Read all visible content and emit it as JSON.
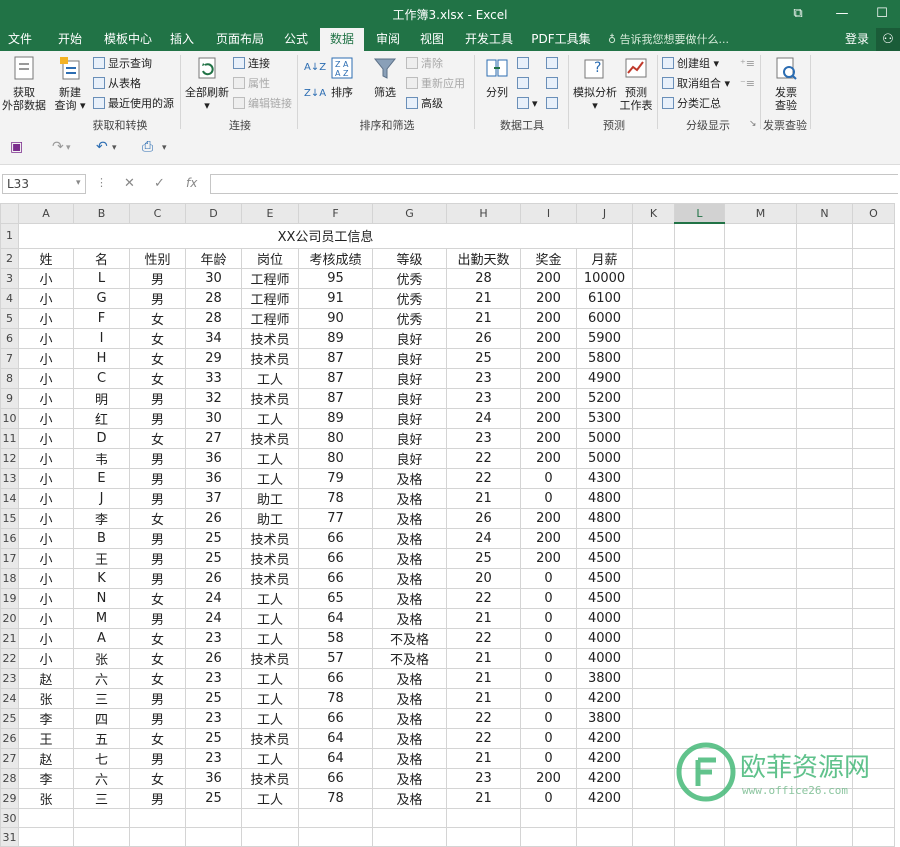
{
  "window": {
    "title": "工作簿3.xlsx - Excel",
    "controls": [
      "⧉",
      "—",
      "☐"
    ]
  },
  "tabs": [
    "文件",
    "开始",
    "模板中心",
    "插入",
    "页面布局",
    "公式",
    "数据",
    "审阅",
    "视图",
    "开发工具",
    "PDF工具集"
  ],
  "active_tab": "数据",
  "tell_me": "告诉我您想要做什么...",
  "login": "登录",
  "ribbon": {
    "groups": {
      "get_transform": "获取和转换",
      "connections": "连接",
      "sort_filter": "排序和筛选",
      "data_tools": "数据工具",
      "forecast": "预测",
      "outline": "分级显示",
      "invoice": "发票查验"
    },
    "get_external_l1": "获取",
    "get_external_l2": "外部数据",
    "new_query_l1": "新建",
    "new_query_l2": "查询",
    "show_queries": "显示查询",
    "from_table": "从表格",
    "recent_sources": "最近使用的源",
    "refresh_all": "全部刷新",
    "connections": "连接",
    "properties": "属性",
    "edit_links": "编辑链接",
    "sort": "排序",
    "filter": "筛选",
    "clear": "清除",
    "reapply": "重新应用",
    "advanced": "高级",
    "split": "分列",
    "what_if_l1": "模拟分析",
    "forecast_l1": "预测",
    "forecast_l2": "工作表",
    "group": "创建组",
    "ungroup": "取消组合",
    "subtotal": "分类汇总",
    "invoice_l1": "发票",
    "invoice_l2": "查验"
  },
  "namebox": "L33",
  "formula_symbols": {
    "cancel": "✕",
    "enter": "✓",
    "fx": "fx"
  },
  "sheet": {
    "columns": [
      "A",
      "B",
      "C",
      "D",
      "E",
      "F",
      "G",
      "H",
      "I",
      "J",
      "K",
      "L",
      "M",
      "N",
      "O"
    ],
    "selected_column": "L",
    "title": "XX公司员工信息",
    "headers": [
      "姓",
      "名",
      "性别",
      "年龄",
      "岗位",
      "考核成绩",
      "等级",
      "出勤天数",
      "奖金",
      "月薪"
    ],
    "rows": [
      [
        "小",
        "L",
        "男",
        "30",
        "工程师",
        "95",
        "优秀",
        "28",
        "200",
        "10000"
      ],
      [
        "小",
        "G",
        "男",
        "28",
        "工程师",
        "91",
        "优秀",
        "21",
        "200",
        "6100"
      ],
      [
        "小",
        "F",
        "女",
        "28",
        "工程师",
        "90",
        "优秀",
        "21",
        "200",
        "6000"
      ],
      [
        "小",
        "I",
        "女",
        "34",
        "技术员",
        "89",
        "良好",
        "26",
        "200",
        "5900"
      ],
      [
        "小",
        "H",
        "女",
        "29",
        "技术员",
        "87",
        "良好",
        "25",
        "200",
        "5800"
      ],
      [
        "小",
        "C",
        "女",
        "33",
        "工人",
        "87",
        "良好",
        "23",
        "200",
        "4900"
      ],
      [
        "小",
        "明",
        "男",
        "32",
        "技术员",
        "87",
        "良好",
        "23",
        "200",
        "5200"
      ],
      [
        "小",
        "红",
        "男",
        "30",
        "工人",
        "89",
        "良好",
        "24",
        "200",
        "5300"
      ],
      [
        "小",
        "D",
        "女",
        "27",
        "技术员",
        "80",
        "良好",
        "23",
        "200",
        "5000"
      ],
      [
        "小",
        "韦",
        "男",
        "36",
        "工人",
        "80",
        "良好",
        "22",
        "200",
        "5000"
      ],
      [
        "小",
        "E",
        "男",
        "36",
        "工人",
        "79",
        "及格",
        "22",
        "0",
        "4300"
      ],
      [
        "小",
        "J",
        "男",
        "37",
        "助工",
        "78",
        "及格",
        "21",
        "0",
        "4800"
      ],
      [
        "小",
        "李",
        "女",
        "26",
        "助工",
        "77",
        "及格",
        "26",
        "200",
        "4800"
      ],
      [
        "小",
        "B",
        "男",
        "25",
        "技术员",
        "66",
        "及格",
        "24",
        "200",
        "4500"
      ],
      [
        "小",
        "王",
        "男",
        "25",
        "技术员",
        "66",
        "及格",
        "25",
        "200",
        "4500"
      ],
      [
        "小",
        "K",
        "男",
        "26",
        "技术员",
        "66",
        "及格",
        "20",
        "0",
        "4500"
      ],
      [
        "小",
        "N",
        "女",
        "24",
        "工人",
        "65",
        "及格",
        "22",
        "0",
        "4500"
      ],
      [
        "小",
        "M",
        "男",
        "24",
        "工人",
        "64",
        "及格",
        "21",
        "0",
        "4000"
      ],
      [
        "小",
        "A",
        "女",
        "23",
        "工人",
        "58",
        "不及格",
        "22",
        "0",
        "4000"
      ],
      [
        "小",
        "张",
        "女",
        "26",
        "技术员",
        "57",
        "不及格",
        "21",
        "0",
        "4000"
      ],
      [
        "赵",
        "六",
        "女",
        "23",
        "工人",
        "66",
        "及格",
        "21",
        "0",
        "3800"
      ],
      [
        "张",
        "三",
        "男",
        "25",
        "工人",
        "78",
        "及格",
        "21",
        "0",
        "4200"
      ],
      [
        "李",
        "四",
        "男",
        "23",
        "工人",
        "66",
        "及格",
        "22",
        "0",
        "3800"
      ],
      [
        "王",
        "五",
        "女",
        "25",
        "技术员",
        "64",
        "及格",
        "22",
        "0",
        "4200"
      ],
      [
        "赵",
        "七",
        "男",
        "23",
        "工人",
        "64",
        "及格",
        "21",
        "0",
        "4200"
      ],
      [
        "李",
        "六",
        "女",
        "36",
        "技术员",
        "66",
        "及格",
        "23",
        "200",
        "4200"
      ],
      [
        "张",
        "三",
        "男",
        "25",
        "工人",
        "78",
        "及格",
        "21",
        "0",
        "4200"
      ]
    ]
  },
  "watermark": {
    "name": "欧菲资源网",
    "url": "www.office26.com"
  }
}
